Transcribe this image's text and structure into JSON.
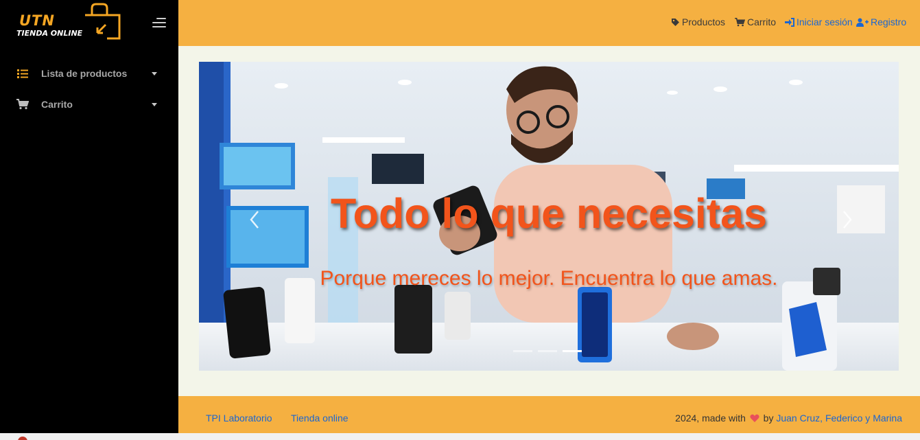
{
  "brand": {
    "logo_text": "UTN",
    "logo_subtitle": "TIENDA ONLINE",
    "accent_color": "#f5a623"
  },
  "sidebar": {
    "toggle_icon": "hamburger-menu-icon",
    "items": [
      {
        "label": "Lista de productos",
        "icon": "list-icon"
      },
      {
        "label": "Carrito",
        "icon": "cart-icon"
      }
    ]
  },
  "header": {
    "background": "#f5b041",
    "nav": [
      {
        "label": "Productos",
        "icon": "tag-icon"
      },
      {
        "label": "Carrito",
        "icon": "cart-icon"
      },
      {
        "label": "Iniciar sesión",
        "icon": "sign-in-icon"
      },
      {
        "label": "Registro",
        "icon": "user-plus-icon"
      }
    ]
  },
  "carousel": {
    "title": "Todo lo que necesitas",
    "text": "Porque mereces lo mejor. Encuentra lo que amas.",
    "caption_color": "#f2541b",
    "slide_count": 3,
    "active_slide": 3
  },
  "footer": {
    "links": [
      "TPI Laboratorio",
      "Tienda online"
    ],
    "credit_prefix": "2024, made with",
    "credit_by": "by",
    "authors": "Juan Cruz, Federico y Marina",
    "heart_icon": "heart-icon"
  }
}
